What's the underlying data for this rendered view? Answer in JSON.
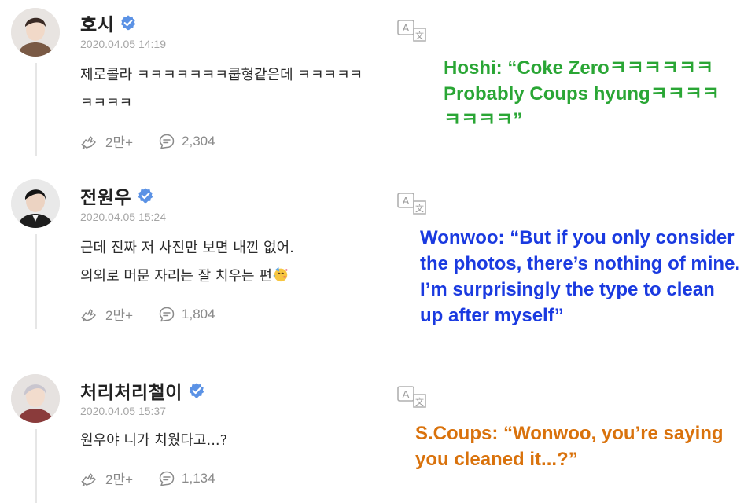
{
  "colors": {
    "verified": "#5b92e5",
    "caption_hoshi": "#2aa635",
    "caption_wonwoo": "#1a3ae0",
    "caption_scoups": "#d9720c",
    "meta_text": "#8a8a8a"
  },
  "posts": [
    {
      "name": "호시",
      "date": "2020.04.05 14:19",
      "lines": [
        "제로콜라 ㅋㅋㅋㅋㅋㅋㅋ쿱형같은데 ㅋㅋㅋㅋㅋ",
        "ㅋㅋㅋㅋ"
      ],
      "likes": "2만+",
      "comments": "2,304",
      "caption_lines": [
        "Hoshi: “Coke Zeroㅋㅋㅋㅋㅋㅋ",
        "Probably Coups hyungㅋㅋㅋㅋ",
        "ㅋㅋㅋㅋ”"
      ]
    },
    {
      "name": "전원우",
      "date": "2020.04.05 15:24",
      "lines": [
        "근데 진짜 저 사진만 보면 내낀 없어.",
        "의외로 머문 자리는 잘 치우는 편"
      ],
      "likes": "2만+",
      "comments": "1,804",
      "caption_lines": [
        "Wonwoo: “But if you only consider",
        "the photos, there’s nothing of mine.",
        "I’m surprisingly the type to clean",
        "up after myself”"
      ]
    },
    {
      "name": "처리처리철이",
      "date": "2020.04.05 15:37",
      "lines": [
        "원우야 니가 치웠다고...?"
      ],
      "likes": "2만+",
      "comments": "1,134",
      "caption_lines": [
        "S.Coups: “Wonwoo, you’re saying",
        "you cleaned it...?”"
      ]
    }
  ],
  "icons": {
    "verified": "verified-badge-icon",
    "translate": "translate-icon",
    "like": "like-hands-icon",
    "comment": "comment-bubble-icon",
    "party": "party-face-emoji"
  }
}
